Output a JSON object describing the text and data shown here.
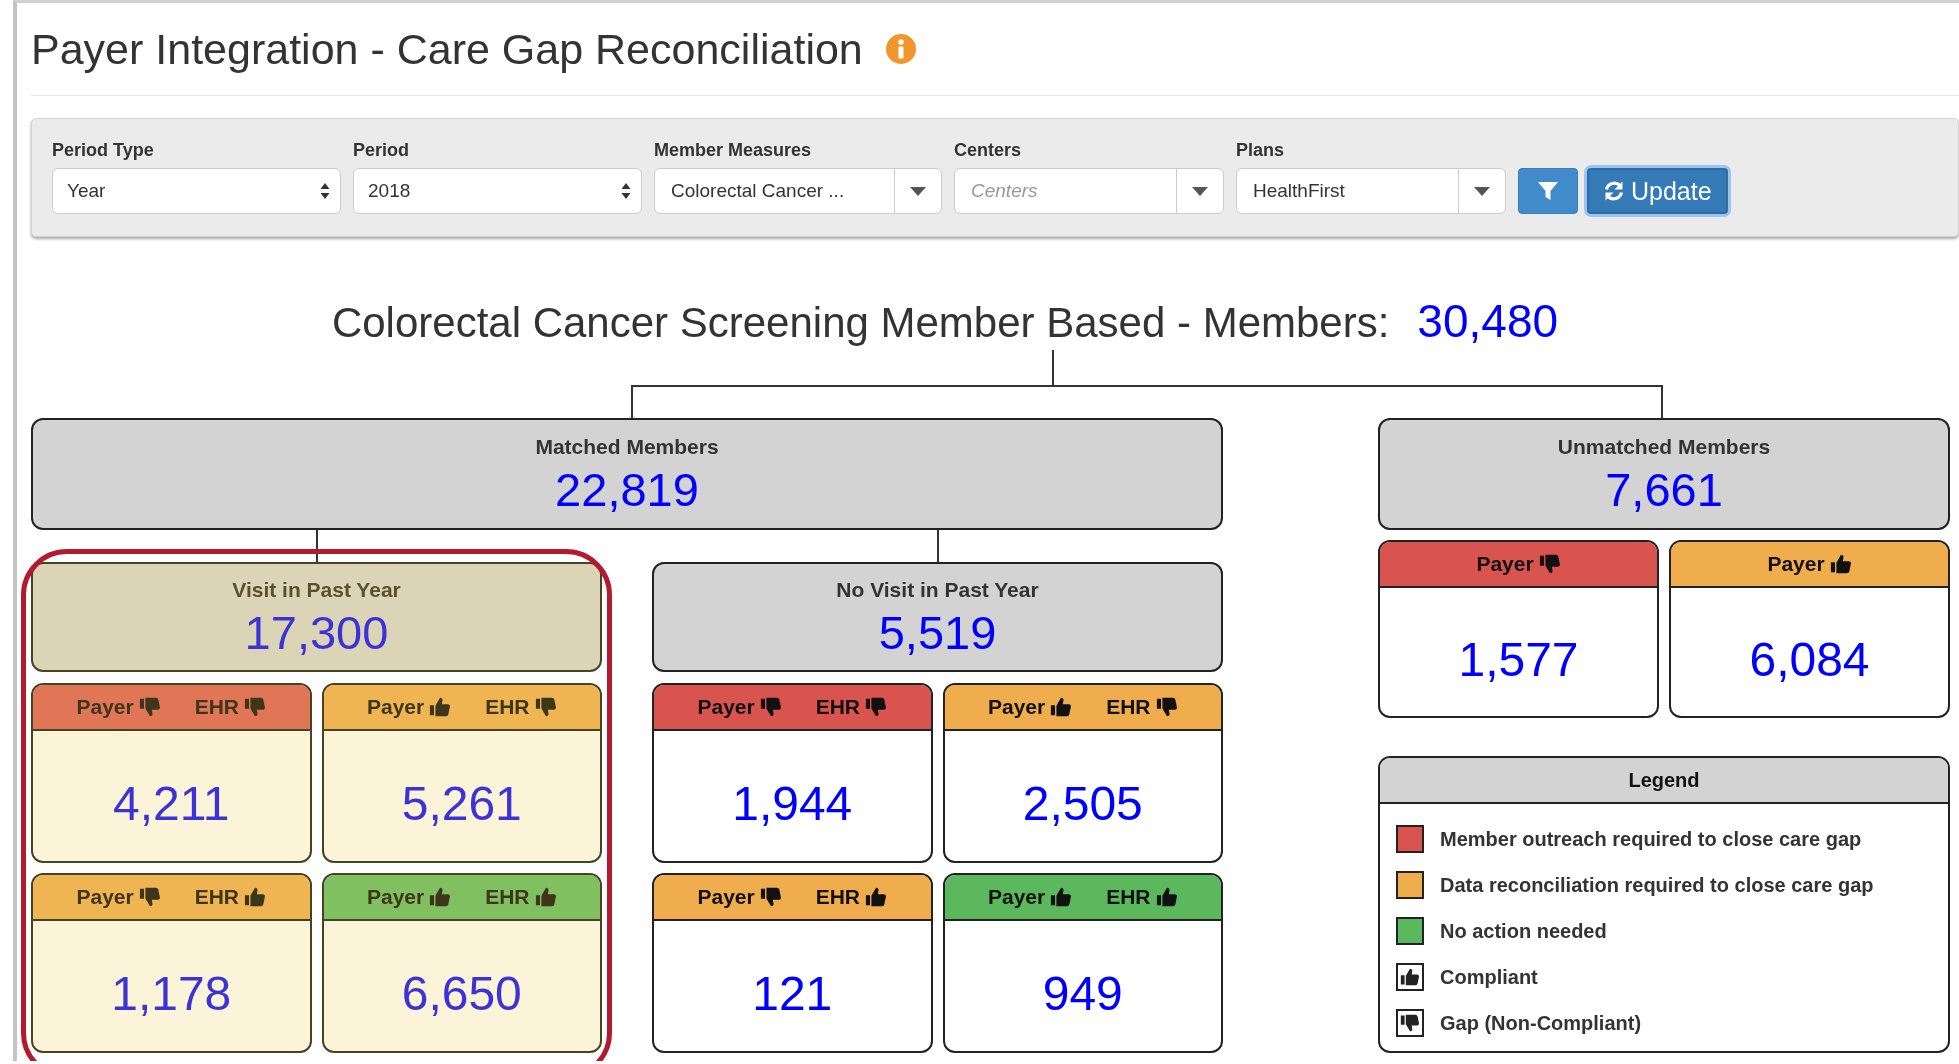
{
  "title": "Payer Integration - Care Gap Reconciliation",
  "filters": [
    {
      "label": "Period Type",
      "kind": "select",
      "value": "Year"
    },
    {
      "label": "Period",
      "kind": "select",
      "value": "2018"
    },
    {
      "label": "Member Measures",
      "kind": "dropdown",
      "value": "Colorectal Cancer ..."
    },
    {
      "label": "Centers",
      "kind": "dropdown",
      "placeholder": "Centers"
    },
    {
      "label": "Plans",
      "kind": "dropdown",
      "value": "HealthFirst"
    }
  ],
  "update_button": "Update",
  "summary": {
    "heading": "Colorectal Cancer Screening Member Based - Members:",
    "count": "30,480"
  },
  "matched": {
    "title": "Matched Members",
    "count": "22,819",
    "groups": [
      {
        "title": "Visit in Past Year",
        "count": "17,300",
        "highlighted": true,
        "cells": [
          {
            "color": "#e07656",
            "count": "4,211",
            "flags": [
              {
                "label": "Payer",
                "compliant": false
              },
              {
                "label": "EHR",
                "compliant": false
              }
            ]
          },
          {
            "color": "#f0b553",
            "count": "5,261",
            "flags": [
              {
                "label": "Payer",
                "compliant": true
              },
              {
                "label": "EHR",
                "compliant": false
              }
            ]
          },
          {
            "color": "#f0b553",
            "count": "1,178",
            "flags": [
              {
                "label": "Payer",
                "compliant": false
              },
              {
                "label": "EHR",
                "compliant": true
              }
            ]
          },
          {
            "color": "#80c060",
            "count": "6,650",
            "flags": [
              {
                "label": "Payer",
                "compliant": true
              },
              {
                "label": "EHR",
                "compliant": true
              }
            ]
          }
        ]
      },
      {
        "title": "No Visit in Past Year",
        "count": "5,519",
        "highlighted": false,
        "cells": [
          {
            "color": "#d9534f",
            "count": "1,944",
            "flags": [
              {
                "label": "Payer",
                "compliant": false
              },
              {
                "label": "EHR",
                "compliant": false
              }
            ]
          },
          {
            "color": "#f0ad4e",
            "count": "2,505",
            "flags": [
              {
                "label": "Payer",
                "compliant": true
              },
              {
                "label": "EHR",
                "compliant": false
              }
            ]
          },
          {
            "color": "#f0ad4e",
            "count": "121",
            "flags": [
              {
                "label": "Payer",
                "compliant": false
              },
              {
                "label": "EHR",
                "compliant": true
              }
            ]
          },
          {
            "color": "#5cb85c",
            "count": "949",
            "flags": [
              {
                "label": "Payer",
                "compliant": true
              },
              {
                "label": "EHR",
                "compliant": true
              }
            ]
          }
        ]
      }
    ]
  },
  "unmatched": {
    "title": "Unmatched Members",
    "count": "7,661",
    "cells": [
      {
        "color": "#d9534f",
        "count": "1,577",
        "flags": [
          {
            "label": "Payer",
            "compliant": false
          }
        ]
      },
      {
        "color": "#f0ad4e",
        "count": "6,084",
        "flags": [
          {
            "label": "Payer",
            "compliant": true
          }
        ]
      }
    ]
  },
  "legend": {
    "title": "Legend",
    "items": [
      {
        "kind": "swatch",
        "color": "#d9534f",
        "label": "Member outreach required to close care gap"
      },
      {
        "kind": "swatch",
        "color": "#f0ad4e",
        "label": "Data reconciliation required to close care gap"
      },
      {
        "kind": "swatch",
        "color": "#5cb85c",
        "label": "No action needed"
      },
      {
        "kind": "thumb",
        "compliant": true,
        "label": "Compliant"
      },
      {
        "kind": "thumb",
        "compliant": false,
        "label": "Gap (Non-Compliant)"
      }
    ]
  }
}
